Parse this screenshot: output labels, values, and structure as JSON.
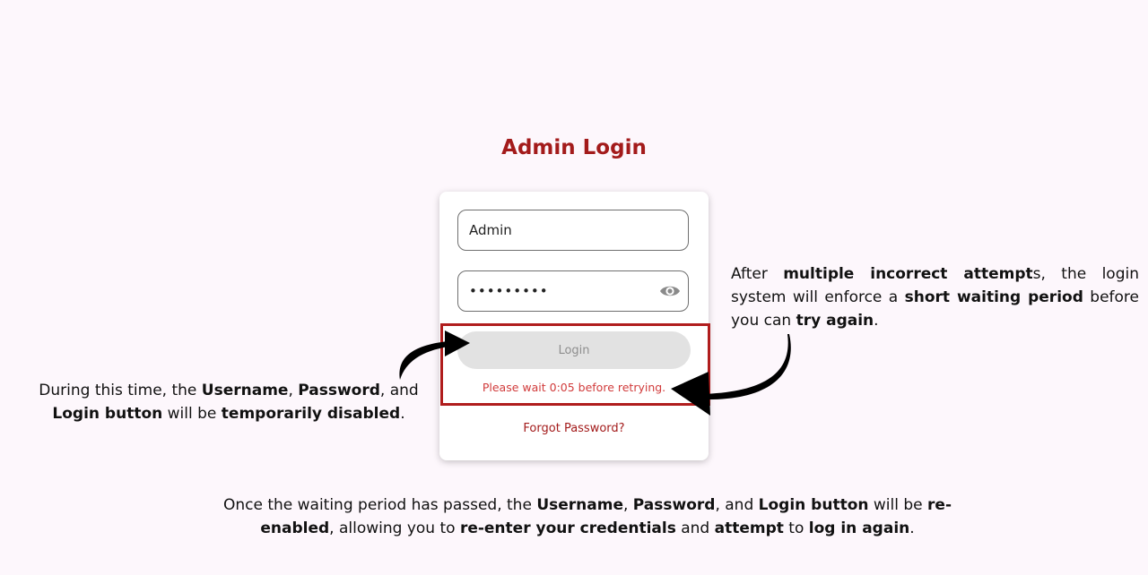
{
  "page_title": "Admin Login",
  "form": {
    "username_value": "Admin",
    "password_value": "•••••••••",
    "password_toggle_icon": "eye-icon",
    "login_label": "Login",
    "wait_message": "Please wait 0:05 before retrying.",
    "forgot_label": "Forgot Password?"
  },
  "annotations": {
    "left": [
      {
        "t": "During this time, the ",
        "b": false
      },
      {
        "t": "Username",
        "b": true
      },
      {
        "t": ", ",
        "b": false
      },
      {
        "t": "Password",
        "b": true
      },
      {
        "t": ", and ",
        "b": false
      },
      {
        "t": "Login button",
        "b": true
      },
      {
        "t": " will be ",
        "b": false
      },
      {
        "t": "temporarily disabled",
        "b": true
      },
      {
        "t": ".",
        "b": false
      }
    ],
    "right": [
      {
        "t": "After ",
        "b": false
      },
      {
        "t": "multiple incorrect attempt",
        "b": true
      },
      {
        "t": "s, the login system will enforce a ",
        "b": false
      },
      {
        "t": "short waiting period",
        "b": true
      },
      {
        "t": " before you can ",
        "b": false
      },
      {
        "t": "try again",
        "b": true
      },
      {
        "t": ".",
        "b": false
      }
    ],
    "bottom": [
      {
        "t": "Once the waiting period has passed, the ",
        "b": false
      },
      {
        "t": "Username",
        "b": true
      },
      {
        "t": ", ",
        "b": false
      },
      {
        "t": "Password",
        "b": true
      },
      {
        "t": ", and ",
        "b": false
      },
      {
        "t": "Login button",
        "b": true
      },
      {
        "t": " will be ",
        "b": false
      },
      {
        "t": "re-enabled",
        "b": true
      },
      {
        "t": ", allowing you to ",
        "b": false
      },
      {
        "t": "re-enter your credentials",
        "b": true
      },
      {
        "t": " and ",
        "b": false
      },
      {
        "t": "attempt",
        "b": true
      },
      {
        "t": " to ",
        "b": false
      },
      {
        "t": "log in again",
        "b": true
      },
      {
        "t": ".",
        "b": false
      }
    ]
  },
  "colors": {
    "brand": "#a31b1b",
    "error": "#d13b3b",
    "highlight_border": "#b01d1d",
    "disabled_button": "#e2e2e2",
    "background": "#fdf7fc"
  }
}
